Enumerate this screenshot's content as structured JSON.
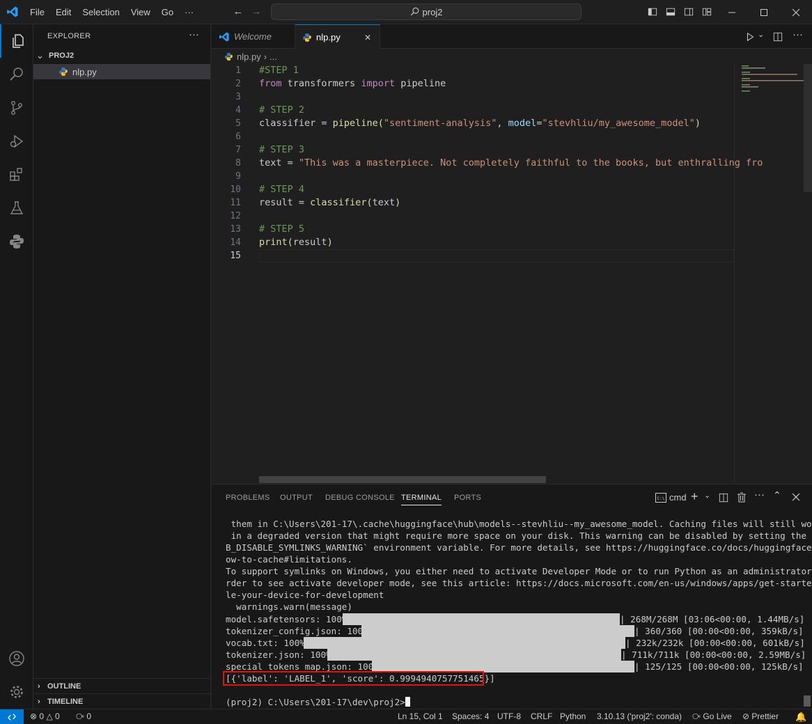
{
  "menu": [
    "File",
    "Edit",
    "Selection",
    "View",
    "Go",
    "···"
  ],
  "search": {
    "label": "proj2"
  },
  "sidebar": {
    "title": "EXPLORER",
    "more": "···",
    "folder": "PROJ2",
    "file": "nlp.py",
    "outline": "OUTLINE",
    "timeline": "TIMELINE"
  },
  "tabs": [
    {
      "label": "Welcome",
      "italic": true
    },
    {
      "label": "nlp.py",
      "active": true,
      "close": "✕"
    }
  ],
  "breadcrumb": {
    "file": "nlp.py",
    "rest": "..."
  },
  "editor": {
    "line_numbers": [
      "1",
      "2",
      "3",
      "4",
      "5",
      "6",
      "7",
      "8",
      "9",
      "10",
      "11",
      "12",
      "13",
      "14",
      "15"
    ],
    "current_line": 15,
    "lines": [
      "#STEP 1",
      "from transformers import pipeline",
      "",
      "# STEP 2",
      "classifier = pipeline(\"sentiment-analysis\", model=\"stevhliu/my_awesome_model\")",
      "",
      "# STEP 3",
      "text = \"This was a masterpiece. Not completely faithful to the books, but enthralling fro",
      "",
      "# STEP 4",
      "result = classifier(text)",
      "",
      "# STEP 5",
      "print(result)",
      ""
    ],
    "tokens": {
      "l1": "#STEP 1",
      "l2_kw1": "from",
      "l2_mod": " transformers ",
      "l2_kw2": "import",
      "l2_name": " pipeline",
      "l4": "# STEP 2",
      "l5_var": "classifier",
      "l5_eq": " = ",
      "l5_fn": "pipeline",
      "l5_p1": "(",
      "l5_s1": "\"sentiment-analysis\"",
      "l5_c": ", ",
      "l5_param": "model",
      "l5_eq2": "=",
      "l5_s2": "\"stevhliu/my_awesome_model\"",
      "l5_p2": ")",
      "l7": "# STEP 3",
      "l8_var": "text",
      "l8_eq": " = ",
      "l8_str": "\"This was a masterpiece. Not completely faithful to the books, but enthralling fro",
      "l10": "# STEP 4",
      "l11_var": "result",
      "l11_eq": " = ",
      "l11_fn": "classifier",
      "l11_p1": "(",
      "l11_arg": "text",
      "l11_p2": ")",
      "l13": "# STEP 5",
      "l14_fn": "print",
      "l14_p1": "(",
      "l14_arg": "result",
      "l14_p2": ")"
    }
  },
  "panel": {
    "tabs": [
      "PROBLEMS",
      "OUTPUT",
      "DEBUG CONSOLE",
      "TERMINAL",
      "PORTS"
    ],
    "active_tab": "TERMINAL",
    "shell": "cmd",
    "terminal_lines": [
      " them in C:\\Users\\201-17\\.cache\\huggingface\\hub\\models--stevhliu--my_awesome_model. Caching files will still work but",
      " in a degraded version that might require more space on your disk. This warning can be disabled by setting the `HF_HU",
      "B_DISABLE_SYMLINKS_WARNING` environment variable. For more details, see https://huggingface.co/docs/huggingface_hub/h",
      "ow-to-cache#limitations.",
      "To support symlinks on Windows, you either need to activate Developer Mode or to run Python as an administrator. In o",
      "rder to see activate developer mode, see this article: https://docs.microsoft.com/en-us/windows/apps/get-started/enab",
      "le-your-device-for-development",
      "  warnings.warn(message)"
    ],
    "downloads": [
      {
        "name": "model.safetensors: 100%|",
        "stats": "| 268M/268M [03:06<00:00, 1.44MB/s]",
        "progress": 1.0
      },
      {
        "name": "tokenizer_config.json: 100%|",
        "stats": "| 360/360 [00:00<00:00, 359kB/s]",
        "progress": 1.0
      },
      {
        "name": "vocab.txt: 100%|",
        "stats": "| 232k/232k [00:00<00:00, 601kB/s]",
        "progress": 1.0
      },
      {
        "name": "tokenizer.json: 100%|",
        "stats": "| 711k/711k [00:00<00:00, 2.59MB/s]",
        "progress": 1.0
      },
      {
        "name": "special_tokens_map.json: 100%|",
        "stats": "| 125/125 [00:00<00:00, 125kB/s]",
        "progress": 1.0
      }
    ],
    "result": "[{'label': 'LABEL_1', 'score': 0.9994940757751465}]",
    "prompt": "(proj2) C:\\Users\\201-17\\dev\\proj2>"
  },
  "status": {
    "errors": "0",
    "warnings": "0",
    "ports": "0",
    "position": "Ln 15, Col 1",
    "spaces": "Spaces: 4",
    "encoding": "UTF-8",
    "eol": "CRLF",
    "language": "Python",
    "interpreter": "3.10.13 ('proj2': conda)",
    "golive": "Go Live",
    "prettier": "Prettier"
  },
  "colors": {
    "accent": "#0078d4",
    "highlight_box": "#e51400"
  }
}
